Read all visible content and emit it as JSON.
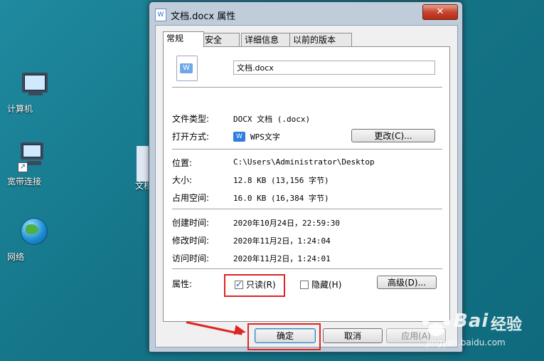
{
  "desktop": {
    "icons": [
      {
        "label": "计算机"
      },
      {
        "label": "宽带连接"
      },
      {
        "label": "网络"
      }
    ],
    "partial_label": "文档"
  },
  "dialog": {
    "title": "文档.docx 属性",
    "close_glyph": "✕",
    "tabs": [
      "常规",
      "安全",
      "详细信息",
      "以前的版本"
    ],
    "file_name": "文档.docx",
    "file_type_label": "文件类型:",
    "file_type_value": "DOCX 文档 (.docx)",
    "open_with_label": "打开方式:",
    "open_with_value": "WPS文字",
    "change_button": "更改(C)...",
    "location_label": "位置:",
    "location_value": "C:\\Users\\Administrator\\Desktop",
    "size_label": "大小:",
    "size_value": "12.8 KB (13,156 字节)",
    "disk_size_label": "占用空间:",
    "disk_size_value": "16.0 KB (16,384 字节)",
    "created_label": "创建时间:",
    "created_value": "2020年10月24日，22:59:30",
    "modified_label": "修改时间:",
    "modified_value": "2020年11月2日，1:24:04",
    "accessed_label": "访问时间:",
    "accessed_value": "2020年11月2日，1:24:01",
    "attributes_label": "属性:",
    "readonly_label": "只读(R)",
    "readonly_checked": true,
    "hidden_label": "隐藏(H)",
    "hidden_checked": false,
    "advanced_button": "高级(D)...",
    "ok_button": "确定",
    "cancel_button": "取消",
    "apply_button": "应用(A)"
  },
  "watermark": {
    "brand": "Bai",
    "brand2": "经验",
    "sub": "jingyan.baidu.com"
  },
  "colors": {
    "highlight": "#e02424",
    "desktop": "#1a7a8c",
    "close": "#c7452f"
  }
}
